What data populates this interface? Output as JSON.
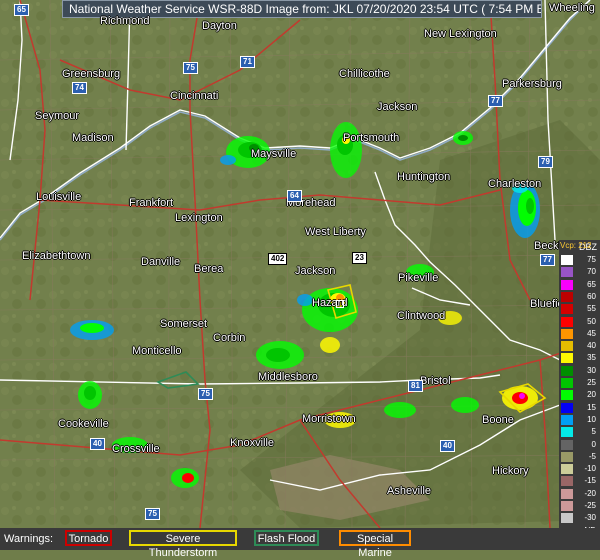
{
  "header": {
    "title": "National Weather Service WSR-88D Image from: JKL 07/20/2020 23:54 UTC ( 7:54 PM EDT)"
  },
  "cities": [
    {
      "name": "Wheeling"
    },
    {
      "name": "Richmond"
    },
    {
      "name": "Dayton"
    },
    {
      "name": "New Lexington"
    },
    {
      "name": "Greensburg"
    },
    {
      "name": "Cincinnati"
    },
    {
      "name": "Chillicothe"
    },
    {
      "name": "Parkersburg"
    },
    {
      "name": "Seymour"
    },
    {
      "name": "Jackson"
    },
    {
      "name": "Madison"
    },
    {
      "name": "Maysville"
    },
    {
      "name": "Portsmouth"
    },
    {
      "name": "Louisville"
    },
    {
      "name": "Huntington"
    },
    {
      "name": "Charleston"
    },
    {
      "name": "Frankfort"
    },
    {
      "name": "Morehead"
    },
    {
      "name": "Lexington"
    },
    {
      "name": "West Liberty"
    },
    {
      "name": "Elizabethtown"
    },
    {
      "name": "Danville"
    },
    {
      "name": "Berea"
    },
    {
      "name": "Jackson"
    },
    {
      "name": "Pikeville"
    },
    {
      "name": "Beckley"
    },
    {
      "name": "Bluefield"
    },
    {
      "name": "Somerset"
    },
    {
      "name": "Clintwood"
    },
    {
      "name": "Monticello"
    },
    {
      "name": "Corbin"
    },
    {
      "name": "Middlesboro"
    },
    {
      "name": "Bristol"
    },
    {
      "name": "Cookeville"
    },
    {
      "name": "Morristown"
    },
    {
      "name": "Boone"
    },
    {
      "name": "Knoxville"
    },
    {
      "name": "Crossville"
    },
    {
      "name": "Hickory"
    },
    {
      "name": "Asheville"
    },
    {
      "name": "Hazard"
    }
  ],
  "shields": [
    "65",
    "74",
    "75",
    "71",
    "77",
    "79",
    "64",
    "402",
    "23",
    "77",
    "81",
    "75",
    "40",
    "75",
    "40"
  ],
  "legend": {
    "unit": "DBZ",
    "vcp": "Vcp: 212",
    "rows": [
      {
        "label": "75",
        "color": "#ffffff"
      },
      {
        "label": "70",
        "color": "#9854c6"
      },
      {
        "label": "65",
        "color": "#f800fd"
      },
      {
        "label": "60",
        "color": "#bc0000"
      },
      {
        "label": "55",
        "color": "#d40000"
      },
      {
        "label": "50",
        "color": "#fd0000"
      },
      {
        "label": "45",
        "color": "#fd9500"
      },
      {
        "label": "40",
        "color": "#e5bc00"
      },
      {
        "label": "35",
        "color": "#fdf802"
      },
      {
        "label": "30",
        "color": "#008e00"
      },
      {
        "label": "25",
        "color": "#01c501"
      },
      {
        "label": "20",
        "color": "#02fd02"
      },
      {
        "label": "15",
        "color": "#0300f4"
      },
      {
        "label": "10",
        "color": "#019ff4"
      },
      {
        "label": "5",
        "color": "#04e9e7"
      },
      {
        "label": "0",
        "color": "#646464"
      },
      {
        "label": "-5",
        "color": "#999966"
      },
      {
        "label": "-10",
        "color": "#cccc99"
      },
      {
        "label": "-15",
        "color": "#996666"
      },
      {
        "label": "-20",
        "color": "#cc9999"
      },
      {
        "label": "-25",
        "color": "#cc9999"
      },
      {
        "label": "-30",
        "color": "#c8c8c8"
      },
      {
        "label": "ND",
        "color": "#3a3a3a"
      }
    ]
  },
  "footer": {
    "warnings_label": "Warnings:",
    "items": [
      {
        "label": "Tornado",
        "color": "#cc0000"
      },
      {
        "label": "Severe Thunderstorm",
        "color": "#e8d800"
      },
      {
        "label": "Flash Flood",
        "color": "#2e8b57"
      },
      {
        "label": "Special Marine",
        "color": "#ff8c00"
      }
    ]
  },
  "colors": {
    "terrain": "#6f7d4a",
    "state_border": "#ffffff",
    "county_border": "#8a7a60",
    "interstate": "#c23a2e",
    "river": "#8faac4"
  }
}
